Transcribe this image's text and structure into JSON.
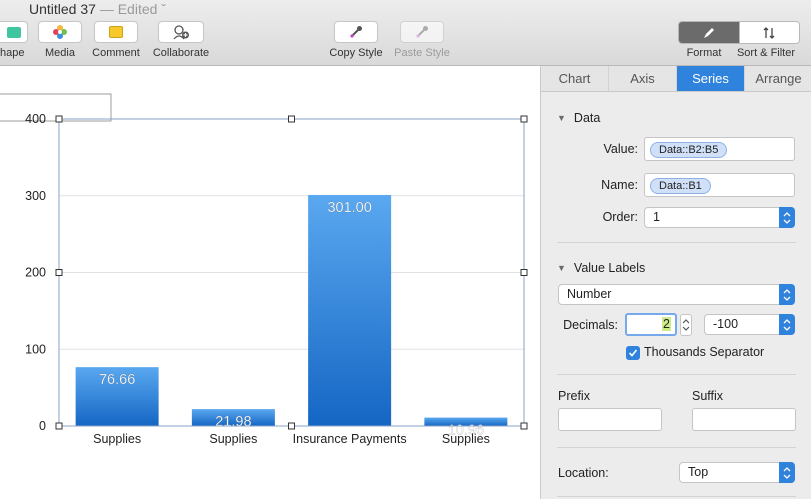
{
  "window": {
    "title": "Untitled 37",
    "edited": "— Edited ˇ"
  },
  "toolbar": {
    "shape_label": "hape",
    "media_label": "Media",
    "comment_label": "Comment",
    "collaborate_label": "Collaborate",
    "copy_style_label": "Copy Style",
    "paste_style_label": "Paste Style",
    "format_label": "Format",
    "sort_filter_label": "Sort & Filter"
  },
  "inspector": {
    "tabs": [
      "Chart",
      "Axis",
      "Series",
      "Arrange"
    ],
    "active_tab": "Series",
    "data_section": {
      "title": "Data",
      "value_label": "Value:",
      "value_token": "Data::B2:B5",
      "name_label": "Name:",
      "name_token": "Data::B1",
      "order_label": "Order:",
      "order_value": "1"
    },
    "value_labels_section": {
      "title": "Value Labels",
      "format": "Number",
      "decimals_label": "Decimals:",
      "decimals_value": "2",
      "negative_format": "-100",
      "thousands_separator_label": "Thousands Separator",
      "thousands_separator_checked": true
    },
    "prefix_label": "Prefix",
    "suffix_label": "Suffix",
    "prefix_value": "",
    "suffix_value": "",
    "location_label": "Location:",
    "location_value": "Top"
  },
  "colors": {
    "accent": "#2f83dd",
    "bar_top": "#5aa8f0",
    "bar_bottom": "#1566c4"
  },
  "chart_data": {
    "type": "bar",
    "categories": [
      "Supplies",
      "Supplies",
      "Insurance Payments",
      "Supplies"
    ],
    "values": [
      76.66,
      21.98,
      301.0,
      10.96
    ],
    "value_labels": [
      "76.66",
      "21.98",
      "301.00",
      "10.96"
    ],
    "yticks": [
      "0",
      "100",
      "200",
      "300",
      "400"
    ],
    "ylim": [
      0,
      400
    ],
    "grid": true,
    "legend": "none",
    "title": "",
    "xlabel": "",
    "ylabel": ""
  }
}
